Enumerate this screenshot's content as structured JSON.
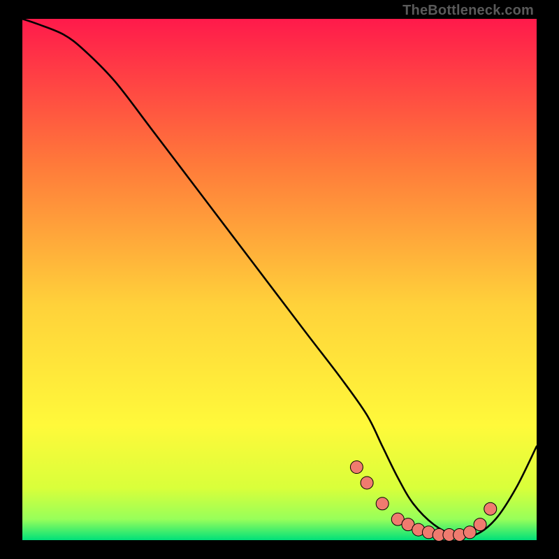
{
  "watermark": "TheBottleneck.com",
  "colors": {
    "top": "#ff1a4b",
    "mid_upper": "#ff7a3a",
    "mid": "#ffd23a",
    "mid_lower": "#fff93a",
    "low1": "#d9ff3a",
    "low2": "#97ff5a",
    "bottom": "#00e07a",
    "curve": "#000000",
    "marker": "#ef7b6f",
    "marker_stroke": "#000000",
    "frame_bg": "#000000"
  },
  "chart_data": {
    "type": "line",
    "title": "",
    "xlabel": "",
    "ylabel": "",
    "xlim": [
      0,
      100
    ],
    "ylim": [
      0,
      100
    ],
    "series": [
      {
        "name": "curve",
        "x": [
          0,
          3,
          8,
          12,
          18,
          25,
          35,
          45,
          55,
          62,
          67,
          70,
          73,
          76,
          80,
          84,
          88,
          92,
          96,
          100
        ],
        "y": [
          100,
          99,
          97,
          94,
          88,
          79,
          66,
          53,
          40,
          31,
          24,
          18,
          12,
          7,
          3,
          1,
          1,
          4,
          10,
          18
        ]
      }
    ],
    "markers": {
      "name": "highlight-points",
      "x": [
        65,
        67,
        70,
        73,
        75,
        77,
        79,
        81,
        83,
        85,
        87,
        89,
        91
      ],
      "y": [
        14,
        11,
        7,
        4,
        3,
        2,
        1.5,
        1,
        1,
        1,
        1.5,
        3,
        6
      ]
    }
  }
}
